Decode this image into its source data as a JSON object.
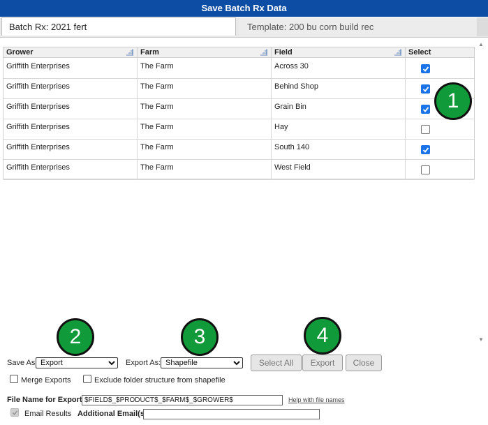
{
  "window": {
    "title": "Save Batch Rx Data"
  },
  "tabs": {
    "batch": "Batch Rx: 2021 fert",
    "template": "Template: 200 bu corn build rec"
  },
  "grid": {
    "columns": [
      "Grower",
      "Farm",
      "Field",
      "Select"
    ],
    "rows": [
      {
        "grower": "Griffith Enterprises",
        "farm": "The Farm",
        "field": "Across 30",
        "selected": true
      },
      {
        "grower": "Griffith Enterprises",
        "farm": "The Farm",
        "field": "Behind Shop",
        "selected": true
      },
      {
        "grower": "Griffith Enterprises",
        "farm": "The Farm",
        "field": "Grain Bin",
        "selected": true
      },
      {
        "grower": "Griffith Enterprises",
        "farm": "The Farm",
        "field": "Hay",
        "selected": false
      },
      {
        "grower": "Griffith Enterprises",
        "farm": "The Farm",
        "field": "South 140",
        "selected": true
      },
      {
        "grower": "Griffith Enterprises",
        "farm": "The Farm",
        "field": "West Field",
        "selected": false
      }
    ]
  },
  "badges": [
    "1",
    "2",
    "3",
    "4"
  ],
  "controls": {
    "save_as_label": "Save As",
    "save_as_value": "Export",
    "export_as_label": "Export As:",
    "export_as_value": "Shapefile",
    "select_all": "Select All",
    "export": "Export",
    "close": "Close",
    "merge_exports": "Merge Exports",
    "exclude_folder": "Exclude folder structure from shapefile",
    "file_name_label": "File Name for Export:",
    "file_name_value": "$FIELD$_$PRODUCT$_$FARM$_$GROWER$",
    "help_link": "Help with file names",
    "email_results": "Email Results",
    "additional_emails_label": "Additional Email(s):",
    "additional_emails_value": ""
  },
  "colors": {
    "titlebar": "#0e4da4",
    "badge": "#119a3a",
    "checkbox_checked": "#1a73e8"
  }
}
